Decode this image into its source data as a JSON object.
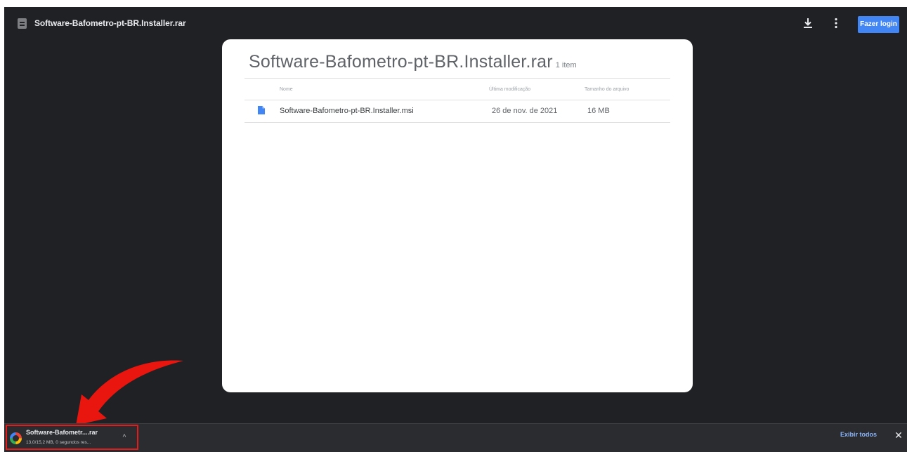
{
  "topbar": {
    "file_name": "Software-Bafometro-pt-BR.Installer.rar",
    "download_icon": "download-icon",
    "more_icon": "more-vert-icon",
    "login_label": "Fazer login"
  },
  "archive": {
    "name": "Software-Bafometro-pt-BR.Installer.rar",
    "item_count": "1 item",
    "columns": {
      "name": "Nome",
      "modified": "Última modificação",
      "size": "Tamanho do arquivo"
    },
    "rows": [
      {
        "icon": "document-icon",
        "name": "Software-Bafometro-pt-BR.Installer.msi",
        "modified": "26 de nov. de 2021",
        "size": "16 MB"
      }
    ]
  },
  "download_bar": {
    "file_name": "Software-Bafometr....rar",
    "status": "13,0/15,2 MB, 0 segundos res...",
    "show_all": "Exibir todos",
    "close": "✕",
    "chevron": "^"
  },
  "colors": {
    "background": "#202124",
    "card": "#ffffff",
    "accent": "#4285f4",
    "highlight": "#e21b1b"
  }
}
